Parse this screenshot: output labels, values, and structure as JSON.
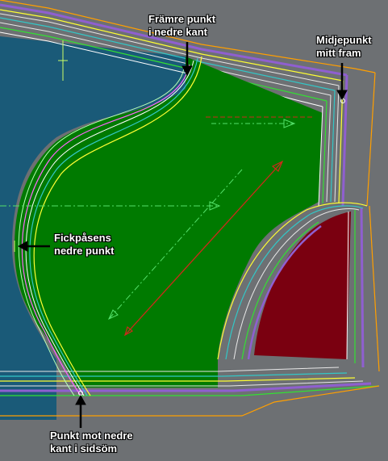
{
  "labels": {
    "front_bottom": {
      "line1": "Främre punkt",
      "line2": "i nedre kant"
    },
    "waist_center": {
      "line1": "Midjepunkt",
      "line2": "mitt fram"
    },
    "pocket_bottom": {
      "line1": "Fickpåsens",
      "line2": "nedre punkt"
    },
    "side_seam": {
      "line1": "Punkt mot nedre",
      "line2": "kant i sidsöm"
    }
  },
  "colors": {
    "background": "#6d7073",
    "blue_panel": "#1a5a78",
    "pocket_fill": "#007a00",
    "facing_fill": "#7a0010",
    "seam_outline": "#ff9f00",
    "grain_line_green": "#54e06a",
    "grain_line_red": "#cc2a1a",
    "arrow": "#000000"
  }
}
